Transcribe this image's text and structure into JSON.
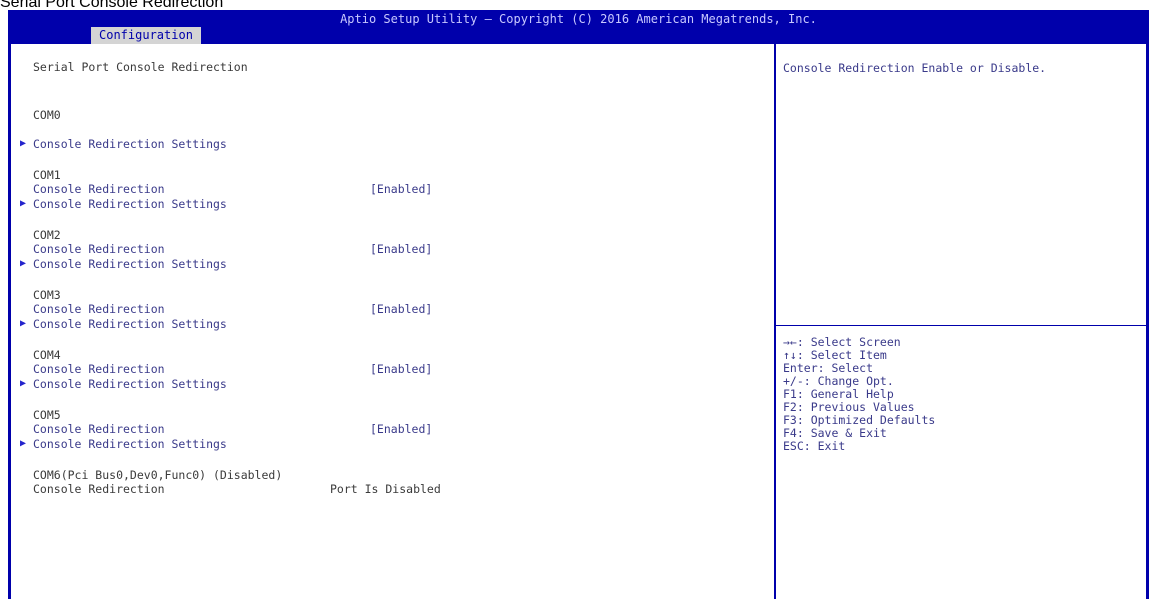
{
  "caption": "Serial Port Console Redirection",
  "title_bar": {
    "title": "Aptio Setup Utility – Copyright (C) 2016 American Megatrends, Inc.",
    "tab": "Configuration"
  },
  "main": {
    "heading": "Serial Port Console Redirection",
    "groups": [
      {
        "name": "COM0",
        "redirection_label": "Console Redirection",
        "redirection_value": "[Enabled]",
        "settings_label": "Console Redirection Settings",
        "selected": true
      },
      {
        "name": "COM1",
        "redirection_label": "Console Redirection",
        "redirection_value": "[Enabled]",
        "settings_label": "Console Redirection Settings"
      },
      {
        "name": "COM2",
        "redirection_label": "Console Redirection",
        "redirection_value": "[Enabled]",
        "settings_label": "Console Redirection Settings"
      },
      {
        "name": "COM3",
        "redirection_label": "Console Redirection",
        "redirection_value": "[Enabled]",
        "settings_label": "Console Redirection Settings"
      },
      {
        "name": "COM4",
        "redirection_label": "Console Redirection",
        "redirection_value": "[Enabled]",
        "settings_label": "Console Redirection Settings"
      },
      {
        "name": "COM5",
        "redirection_label": "Console Redirection",
        "redirection_value": "[Enabled]",
        "settings_label": "Console Redirection Settings"
      }
    ],
    "com6": {
      "name": "COM6(Pci Bus0,Dev0,Func0) (Disabled)",
      "redirection_label": "Console Redirection",
      "redirection_value": "Port Is Disabled"
    }
  },
  "help": {
    "text": "Console Redirection Enable or Disable."
  },
  "keys": [
    "→←: Select Screen",
    "↑↓: Select Item",
    "Enter: Select",
    "+/-: Change Opt.",
    "F1: General Help",
    "F2: Previous Values",
    "F3: Optimized Defaults",
    "F4: Save & Exit",
    "ESC: Exit"
  ],
  "colors": {
    "frame": "#0000ab",
    "tab_bg": "#d4d4d4",
    "item_text": "#3a3a8a",
    "static_text": "#3a3a3a",
    "selected_text": "#ffffff"
  }
}
